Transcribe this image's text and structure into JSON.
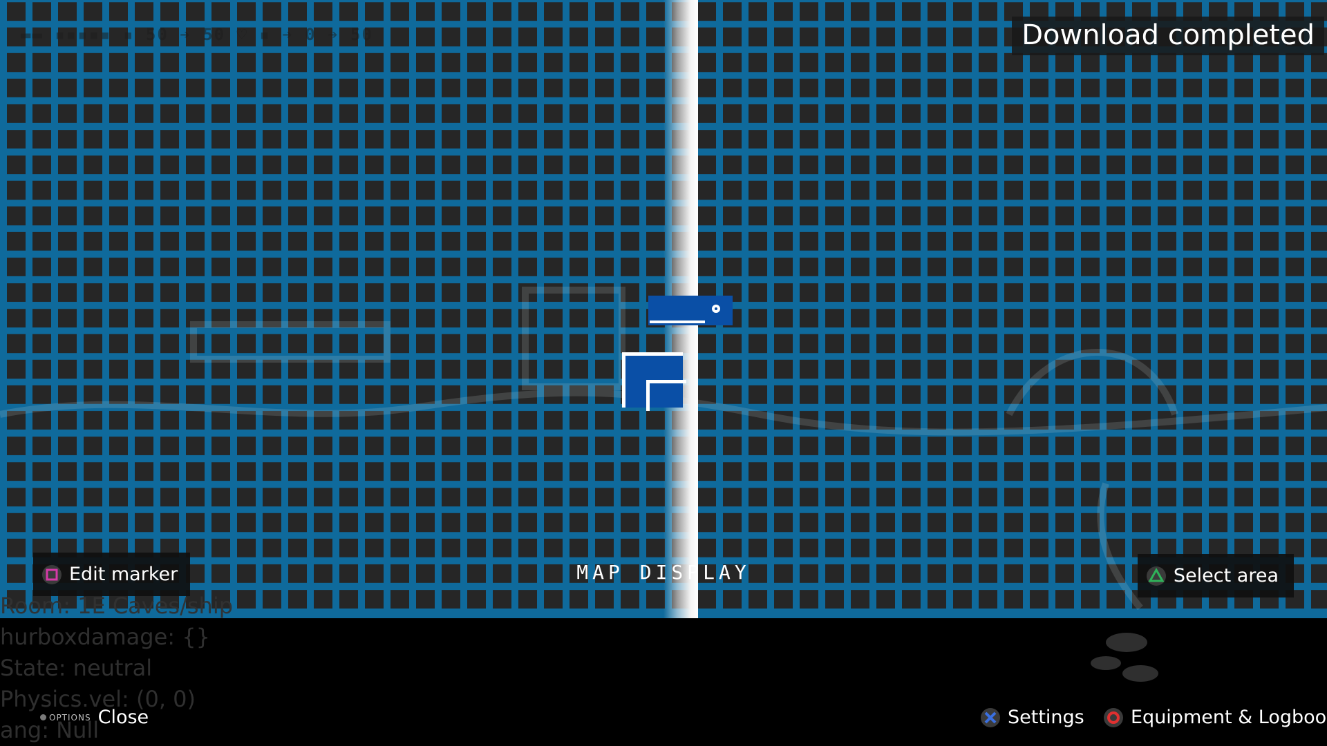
{
  "hud": {
    "stats_text": "▬▬ ▪▪▪▪▪  ▪ 50  ➔ 50  ♡ ▪  ➔ 0  ➔ 50"
  },
  "notification": {
    "text": "Download completed"
  },
  "map": {
    "title": "MAP DISPLAY",
    "grid_color": "#0f6a9c",
    "room_color": "#0a4fa6",
    "background_color": "#262626"
  },
  "prompts": {
    "edit_marker": {
      "label": "Edit marker",
      "button": "square",
      "button_color": "#d63aa8"
    },
    "select_area": {
      "label": "Select area",
      "button": "triangle",
      "button_color": "#2fb35a"
    },
    "close": {
      "options_label": "OPTIONS",
      "label": "Close"
    },
    "settings": {
      "label": "Settings",
      "button": "cross",
      "button_color": "#3a6fe0"
    },
    "equipment": {
      "label": "Equipment & Logbook",
      "button": "circle",
      "button_color": "#e03030"
    }
  },
  "debug": {
    "lines": [
      "Room: 1E Caves/ship",
      "hurboxdamage: {}",
      "State: neutral",
      "Physics.vel: (0, 0)",
      "ang: Null"
    ]
  }
}
